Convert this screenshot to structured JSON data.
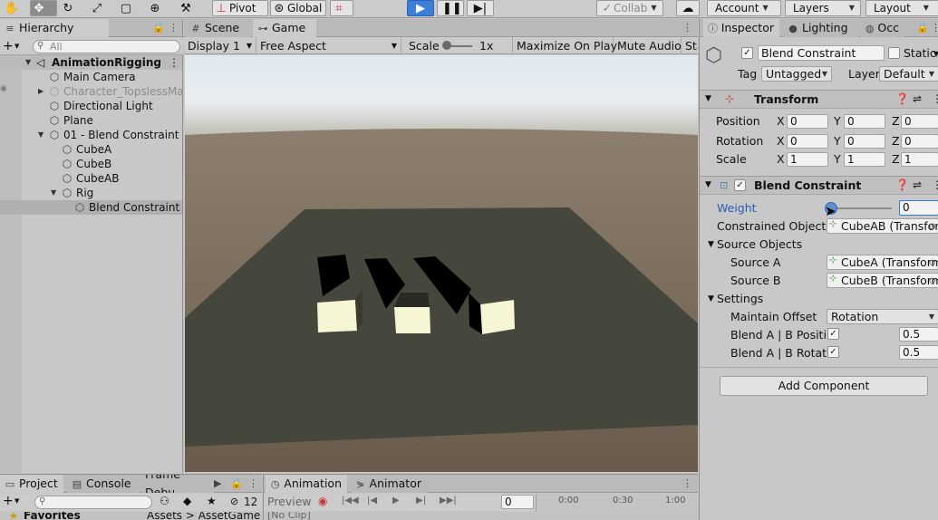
{
  "toolbar": {
    "pivot_label": "Pivot",
    "global_label": "Global",
    "collab_label": "Collab",
    "account_label": "Account",
    "layers_label": "Layers",
    "layout_label": "Layout"
  },
  "hierarchy": {
    "tab_label": "Hierarchy",
    "search_placeholder": "All",
    "scene_name": "AnimationRigging",
    "items": [
      {
        "label": "Main Camera"
      },
      {
        "label": "Character_TopslessMale"
      },
      {
        "label": "Directional Light"
      },
      {
        "label": "Plane"
      },
      {
        "label": "01 - Blend Constraint"
      },
      {
        "label": "CubeA"
      },
      {
        "label": "CubeB"
      },
      {
        "label": "CubeAB"
      },
      {
        "label": "Rig"
      },
      {
        "label": "Blend Constraint"
      }
    ]
  },
  "game": {
    "tabs": [
      {
        "label": "Scene"
      },
      {
        "label": "Game"
      }
    ],
    "display": "Display 1",
    "aspect": "Free Aspect",
    "scale_label": "Scale",
    "scale_value": "1x",
    "maximize": "Maximize On Play",
    "mute": "Mute Audio",
    "stats": "Sta"
  },
  "inspector": {
    "tabs": [
      {
        "label": "Inspector"
      },
      {
        "label": "Lighting"
      },
      {
        "label": "Occ"
      }
    ],
    "object_name": "Blend Constraint",
    "static_label": "Static",
    "tag_label": "Tag",
    "tag_value": "Untagged",
    "layer_label": "Layer",
    "layer_value": "Default",
    "transform": {
      "title": "Transform",
      "position_label": "Position",
      "rotation_label": "Rotation",
      "scale_label": "Scale",
      "x_label": "X",
      "y_label": "Y",
      "z_label": "Z",
      "position": [
        "0",
        "0",
        "0"
      ],
      "rotation": [
        "0",
        "0",
        "0"
      ],
      "scale": [
        "1",
        "1",
        "1"
      ]
    },
    "blend": {
      "title": "Blend Constraint",
      "weight_label": "Weight",
      "weight_value": "0",
      "weight_slider": 0,
      "constrained_label": "Constrained Object",
      "constrained_value": "CubeAB (Transform)",
      "source_objects_label": "Source Objects",
      "source_a_label": "Source A",
      "source_a_value": "CubeA (Transform)",
      "source_b_label": "Source B",
      "source_b_value": "CubeB (Transform)",
      "settings_label": "Settings",
      "maintain_offset_label": "Maintain Offset",
      "maintain_offset_value": "Rotation",
      "blend_pos_label": "Blend A | B Position",
      "blend_pos_value": "0.5",
      "blend_rot_label": "Blend A | B Rotation",
      "blend_rot_value": "0.5"
    },
    "add_component": "Add Component"
  },
  "project": {
    "tabs": [
      {
        "label": "Project"
      },
      {
        "label": "Console"
      },
      {
        "label": "Frame Debu"
      }
    ],
    "hidden_count": "12",
    "favorites": "Favorites",
    "breadcrumb": "Assets > AssetGame"
  },
  "animation": {
    "tabs": [
      {
        "label": "Animation"
      },
      {
        "label": "Animator"
      }
    ],
    "preview_label": "Preview",
    "frame_value": "0",
    "clip": "[No Clip]",
    "ticks": [
      "0:00",
      "0:30",
      "1:00"
    ]
  }
}
